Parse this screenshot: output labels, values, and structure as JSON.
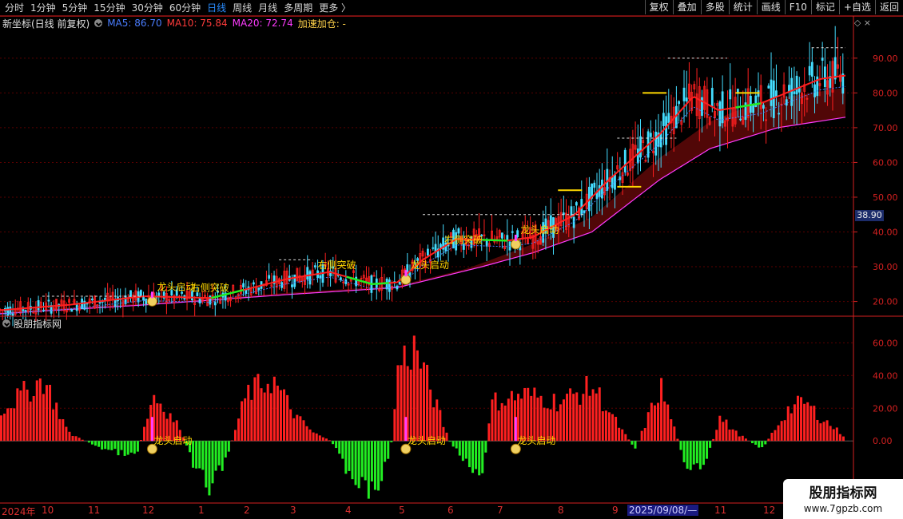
{
  "toolbar": {
    "periods": [
      {
        "label": "分时",
        "active": false
      },
      {
        "label": "1分钟",
        "active": false
      },
      {
        "label": "5分钟",
        "active": false
      },
      {
        "label": "15分钟",
        "active": false
      },
      {
        "label": "30分钟",
        "active": false
      },
      {
        "label": "60分钟",
        "active": false
      },
      {
        "label": "日线",
        "active": true
      },
      {
        "label": "周线",
        "active": false
      },
      {
        "label": "月线",
        "active": false
      },
      {
        "label": "多周期",
        "active": false
      },
      {
        "label": "更多 〉",
        "active": false
      }
    ],
    "actions": [
      "复权",
      "叠加",
      "多股",
      "统计",
      "画线",
      "F10",
      "标记",
      "+自选",
      "返回"
    ]
  },
  "main_header": {
    "title": "新坐标(日线 前复权)",
    "ma5": "MA5: 86.70",
    "ma10": "MA10: 75.84",
    "ma20": "MA20: 72.74",
    "accel": "加速加仓: -"
  },
  "sub_header": {
    "title": "股朋指标网"
  },
  "price_badge": "38.90",
  "watermark": {
    "title": "股朋指标网",
    "url": "www.7gpzb.com"
  },
  "colors": {
    "up": "#ff2020",
    "down": "#22ee22",
    "ma5": "#4a7dff",
    "ma10": "#ff2020",
    "ma20": "#ff3bff",
    "yellow": "#ffd800",
    "grid": "#5a0000",
    "axis": "#d42020",
    "band": "#5a0808"
  },
  "chart_data": [
    {
      "type": "line",
      "title": "新坐标(日线 前复权)",
      "y_ticks": [
        "20.00",
        "30.00",
        "40.00",
        "50.00",
        "60.00",
        "70.00",
        "80.00",
        "90.00"
      ],
      "ylim": [
        16,
        98
      ],
      "series": [
        {
          "name": "MA10",
          "approx_points": [
            [
              0,
              17.5
            ],
            [
              0.08,
              19
            ],
            [
              0.17,
              21.5
            ],
            [
              0.25,
              21
            ],
            [
              0.34,
              26.5
            ],
            [
              0.39,
              28.5
            ],
            [
              0.44,
              25
            ],
            [
              0.47,
              25.5
            ],
            [
              0.5,
              32
            ],
            [
              0.54,
              38
            ],
            [
              0.6,
              37.5
            ],
            [
              0.63,
              38.5
            ],
            [
              0.68,
              45
            ],
            [
              0.72,
              55
            ],
            [
              0.78,
              68
            ],
            [
              0.82,
              79
            ],
            [
              0.85,
              75
            ],
            [
              0.9,
              77
            ],
            [
              0.94,
              81
            ],
            [
              0.97,
              84
            ],
            [
              1.0,
              85
            ]
          ]
        },
        {
          "name": "MA20",
          "approx_points": [
            [
              0,
              16.5
            ],
            [
              0.17,
              19
            ],
            [
              0.34,
              22
            ],
            [
              0.47,
              24
            ],
            [
              0.57,
              30
            ],
            [
              0.63,
              34
            ],
            [
              0.7,
              40
            ],
            [
              0.78,
              55
            ],
            [
              0.84,
              64
            ],
            [
              0.92,
              70
            ],
            [
              1.0,
              73
            ]
          ]
        }
      ],
      "annotations": [
        {
          "text": "右侧突破",
          "x": 0.22
        },
        {
          "text": "龙头启动",
          "x": 0.18
        },
        {
          "text": "右侧突破",
          "x": 0.37
        },
        {
          "text": "右侧突破",
          "x": 0.52
        },
        {
          "text": "龙头启动",
          "x": 0.48
        },
        {
          "text": "龙头启动",
          "x": 0.61
        }
      ]
    },
    {
      "type": "bar",
      "title": "股朋指标网",
      "y_ticks": [
        "0.00",
        "20.00",
        "40.00",
        "60.00"
      ],
      "ylim": [
        -37,
        67
      ],
      "annotations": [
        {
          "text": "龙头启动",
          "x": 0.18
        },
        {
          "text": "龙头启动",
          "x": 0.48
        },
        {
          "text": "龙头启动",
          "x": 0.61
        }
      ]
    }
  ],
  "date_axis": [
    {
      "label": "2024年",
      "x": 2
    },
    {
      "label": "10",
      "x": 52
    },
    {
      "label": "11",
      "x": 110
    },
    {
      "label": "12",
      "x": 178
    },
    {
      "label": "1",
      "x": 248
    },
    {
      "label": "2",
      "x": 305
    },
    {
      "label": "3",
      "x": 363
    },
    {
      "label": "4",
      "x": 432
    },
    {
      "label": "5",
      "x": 499
    },
    {
      "label": "6",
      "x": 560
    },
    {
      "label": "7",
      "x": 622
    },
    {
      "label": "8",
      "x": 698
    },
    {
      "label": "9",
      "x": 766
    },
    {
      "label": "2025/09/08/—",
      "x": 785,
      "highlight": true
    },
    {
      "label": "11",
      "x": 894
    },
    {
      "label": "12",
      "x": 955
    }
  ]
}
